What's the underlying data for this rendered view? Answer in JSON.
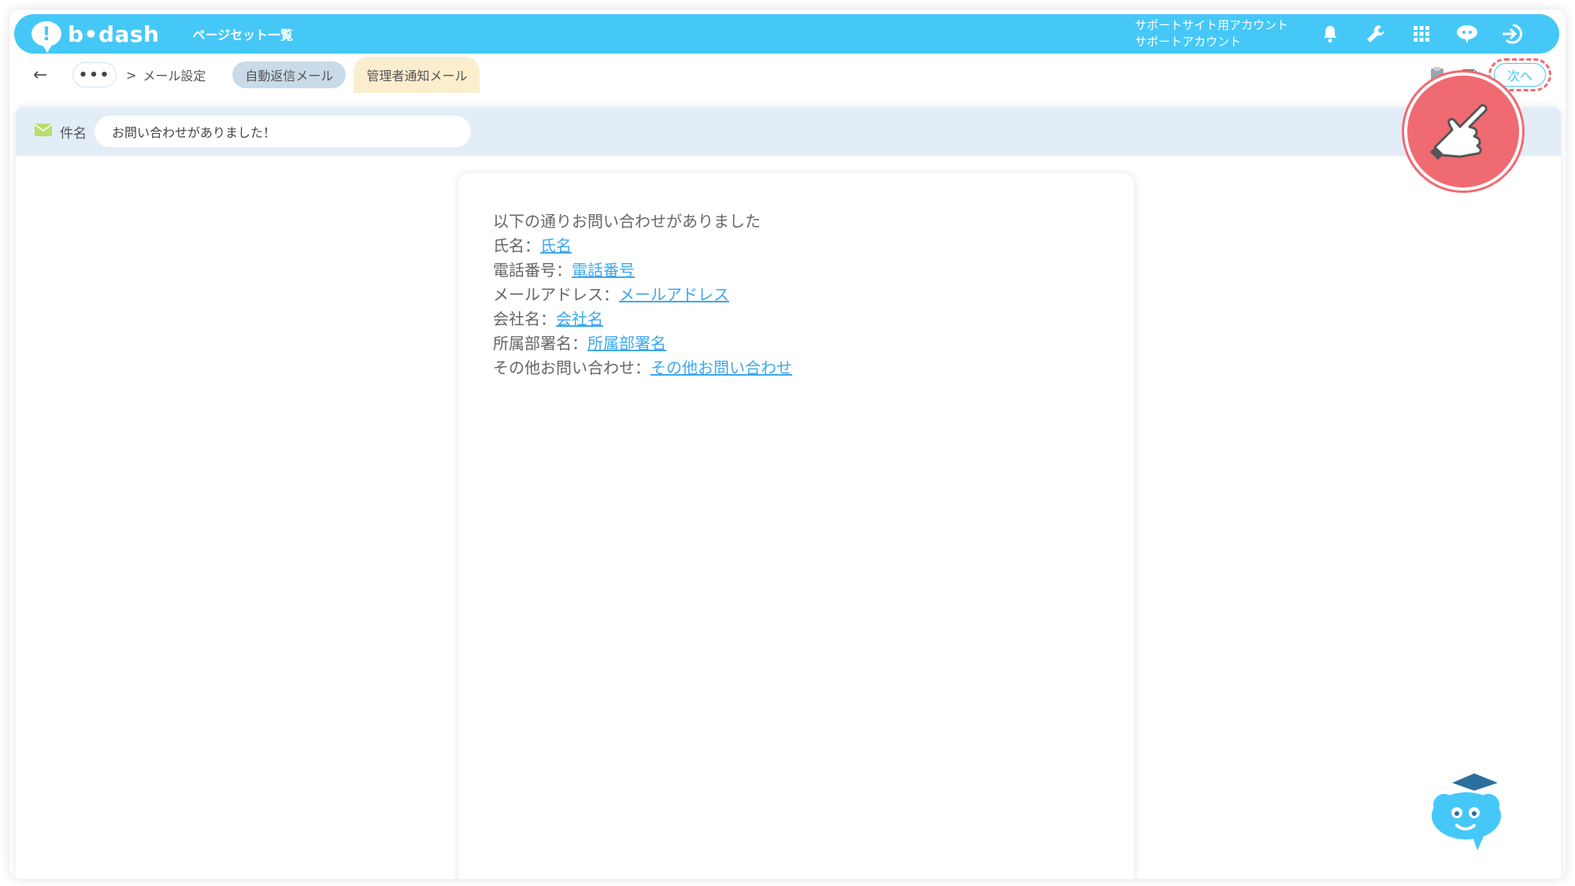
{
  "header": {
    "logo_text": "b•dash",
    "page_list_label": "ページセット一覧",
    "account_line1": "サポートサイト用アカウント",
    "account_line2": "サポートアカウント",
    "icons": [
      "bell-icon",
      "wrench-icon",
      "grid-icon",
      "mascot-icon",
      "logout-icon"
    ]
  },
  "breadcrumb": {
    "more_label": "•••",
    "separator": ">",
    "current": "メール設定"
  },
  "tabs": {
    "auto_reply": "自動返信メール",
    "admin_notice": "管理者通知メール"
  },
  "toolbar": {
    "next_label": "次へ"
  },
  "subject": {
    "label": "件名",
    "value": "お問い合わせがありました！"
  },
  "body": {
    "intro": "以下の通りお問い合わせがありました",
    "fields": [
      {
        "label": "氏名：",
        "link": "氏名"
      },
      {
        "label": "電話番号：",
        "link": "電話番号"
      },
      {
        "label": "メールアドレス：",
        "link": "メールアドレス"
      },
      {
        "label": "会社名：",
        "link": "会社名"
      },
      {
        "label": "所属部署名：",
        "link": "所属部署名"
      },
      {
        "label": "その他お問い合わせ：",
        "link": "その他お問い合わせ"
      }
    ]
  },
  "colors": {
    "brand": "#45c8f8",
    "highlight": "#f06a72",
    "admin_tab": "#fbeece",
    "auto_tab": "#c9dbe8",
    "link": "#3da8ef"
  }
}
